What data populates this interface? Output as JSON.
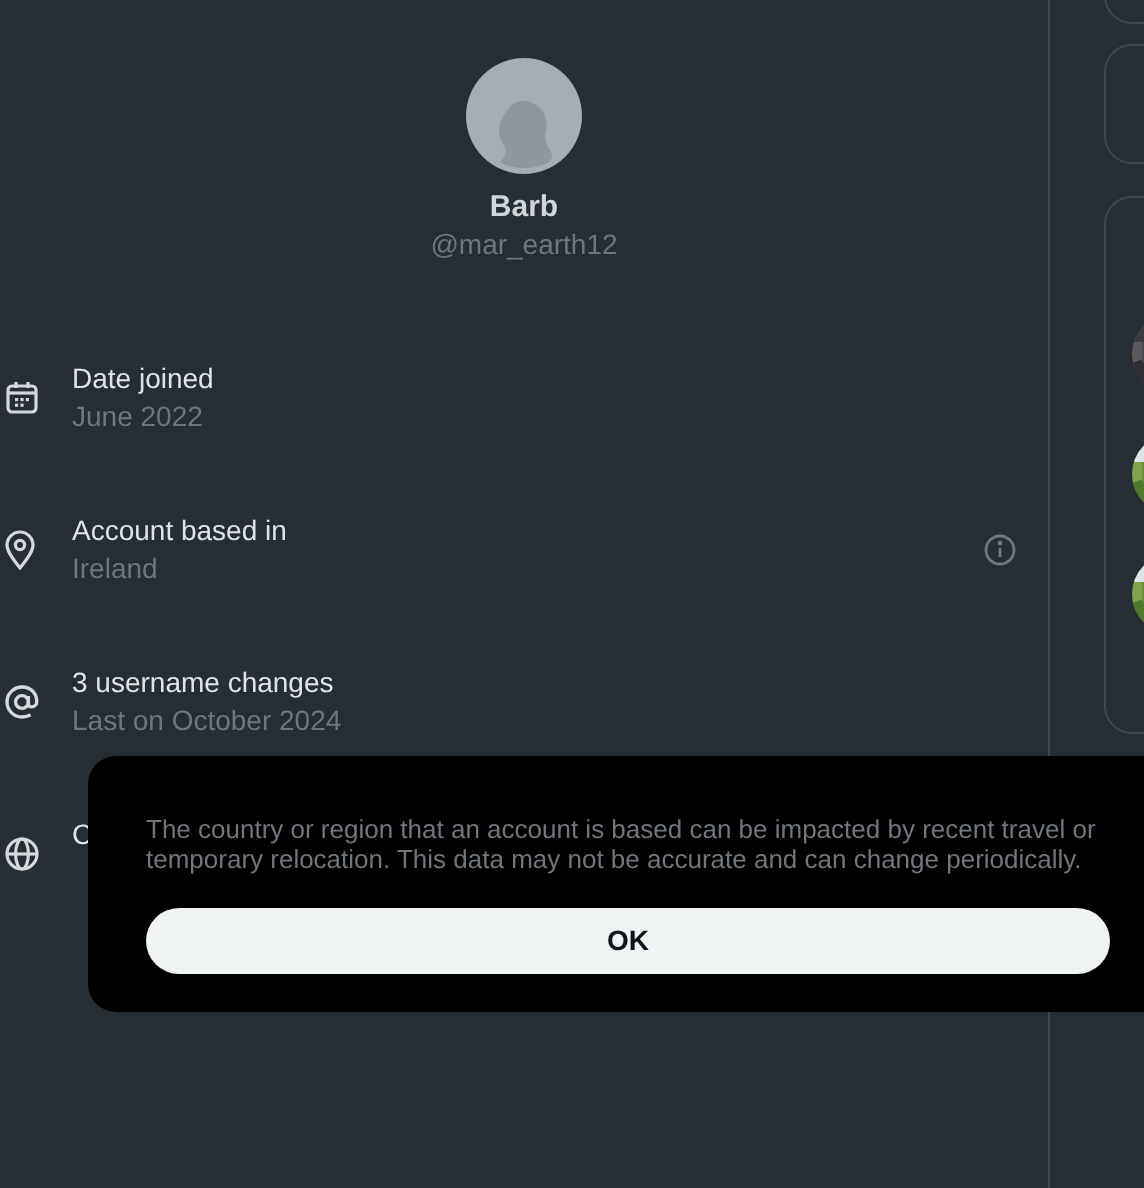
{
  "profile": {
    "name": "Barb",
    "handle": "@mar_earth12"
  },
  "details": [
    {
      "kind": "calendar",
      "title": "Date joined",
      "subtitle": "June 2022",
      "info": false
    },
    {
      "kind": "location",
      "title": "Account based in",
      "subtitle": "Ireland",
      "info": true
    },
    {
      "kind": "at",
      "title": "3 username changes",
      "subtitle": "Last on October 2024",
      "info": false
    },
    {
      "kind": "globe",
      "title": "C"
    }
  ],
  "dialog": {
    "message": "The country or region that an account is based can be impacted by recent travel or temporary relocation. This data may not be accurate and can change periodically.",
    "button": "OK"
  }
}
